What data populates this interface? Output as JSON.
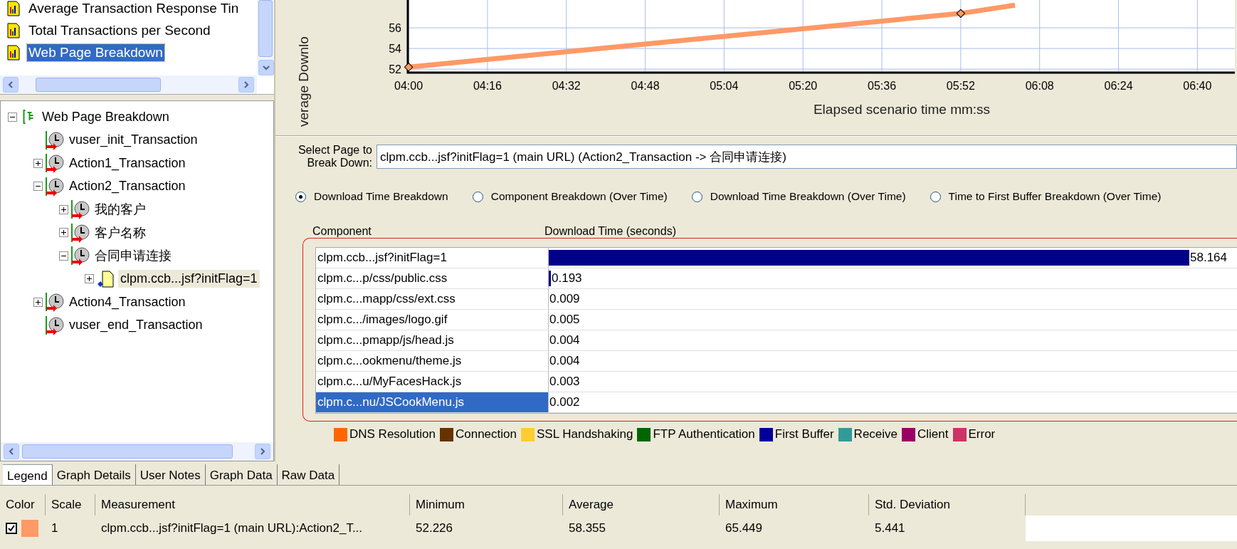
{
  "graph_list": {
    "items": [
      {
        "label": "Average Transaction Response Tin",
        "selected": false
      },
      {
        "label": "Total Transactions per Second",
        "selected": false
      },
      {
        "label": "Web Page Breakdown",
        "selected": true
      }
    ]
  },
  "tree": {
    "items": [
      {
        "label": "Web Page Breakdown",
        "kind": "root",
        "expanded": true,
        "selected": false,
        "children": [
          {
            "label": "vuser_init_Transaction",
            "kind": "transaction",
            "selected": false
          },
          {
            "label": "Action1_Transaction",
            "kind": "transaction",
            "expanded": false,
            "selected": false
          },
          {
            "label": "Action2_Transaction",
            "kind": "transaction",
            "expanded": true,
            "selected": false,
            "children": [
              {
                "label": "我的客户",
                "kind": "transaction",
                "expanded": false,
                "selected": false
              },
              {
                "label": "客户名称",
                "kind": "transaction",
                "expanded": false,
                "selected": false
              },
              {
                "label": "合同申请连接",
                "kind": "transaction",
                "expanded": true,
                "selected": false,
                "children": [
                  {
                    "label": "clpm.ccb...jsf?initFlag=1",
                    "kind": "page",
                    "expanded": false,
                    "selected": true
                  }
                ]
              }
            ]
          },
          {
            "label": "Action4_Transaction",
            "kind": "transaction",
            "expanded": false,
            "selected": false
          },
          {
            "label": "vuser_end_Transaction",
            "kind": "transaction",
            "selected": false
          }
        ]
      }
    ]
  },
  "chart": {
    "chart_data": {
      "type": "line",
      "xlabel": "Elapsed scenario time mm:ss",
      "annotations": [
        {
          "text": "verage Downlo"
        }
      ],
      "grid": true,
      "x": [
        240,
        352,
        363
      ],
      "series": [
        {
          "color": "#ff9966",
          "values": [
            52.2,
            57.4,
            58.2
          ]
        }
      ],
      "xlim": [
        239.7,
        407.6
      ],
      "ylim": [
        51.8,
        58.7
      ],
      "xticks": [
        {
          "value": 240,
          "label": "04:00"
        },
        {
          "value": 256,
          "label": "04:16"
        },
        {
          "value": 272,
          "label": "04:32"
        },
        {
          "value": 288,
          "label": "04:48"
        },
        {
          "value": 304,
          "label": "05:04"
        },
        {
          "value": 320,
          "label": "05:20"
        },
        {
          "value": 336,
          "label": "05:36"
        },
        {
          "value": 352,
          "label": "05:52"
        },
        {
          "value": 368,
          "label": "06:08"
        },
        {
          "value": 384,
          "label": "06:24"
        },
        {
          "value": 400,
          "label": "06:40"
        }
      ],
      "yticks": [
        52,
        54,
        56
      ]
    }
  },
  "select_page": {
    "label": "Select Page to Break Down:",
    "value": "clpm.ccb...jsf?initFlag=1 (main URL) (Action2_Transaction -> 合同申请连接)"
  },
  "breakdown_options": [
    {
      "label": "Download Time Breakdown",
      "selected": true
    },
    {
      "label": "Component Breakdown (Over Time)",
      "selected": false
    },
    {
      "label": "Download Time Breakdown (Over Time)",
      "selected": false
    },
    {
      "label": "Time to First Buffer Breakdown (Over Time)",
      "selected": false
    }
  ],
  "breakdown_table": {
    "columns": [
      "Component",
      "Download Time (seconds)"
    ],
    "rows": [
      {
        "component": "clpm.ccb...jsf?initFlag=1",
        "time": "58.164",
        "selected": false
      },
      {
        "component": "clpm.c...p/css/public.css",
        "time": "0.193",
        "selected": false
      },
      {
        "component": "clpm.c...mapp/css/ext.css",
        "time": "0.009",
        "selected": false
      },
      {
        "component": "clpm.c.../images/logo.gif",
        "time": "0.005",
        "selected": false
      },
      {
        "component": "clpm.c...pmapp/js/head.js",
        "time": "0.004",
        "selected": false
      },
      {
        "component": "clpm.c...ookmenu/theme.js",
        "time": "0.004",
        "selected": false
      },
      {
        "component": "clpm.c...u/MyFacesHack.js",
        "time": "0.003",
        "selected": false
      },
      {
        "component": "clpm.c...nu/JSCookMenu.js",
        "time": "0.002",
        "selected": true
      }
    ]
  },
  "legend": [
    {
      "label": "DNS Resolution",
      "color": "#ff6600"
    },
    {
      "label": "Connection",
      "color": "#663300"
    },
    {
      "label": "SSL Handshaking",
      "color": "#ffcc33"
    },
    {
      "label": "FTP Authentication",
      "color": "#006600"
    },
    {
      "label": "First Buffer",
      "color": "#000099"
    },
    {
      "label": "Receive",
      "color": "#339999"
    },
    {
      "label": "Client",
      "color": "#990066"
    },
    {
      "label": "Error",
      "color": "#cc3366"
    }
  ],
  "bottom_tabs": [
    {
      "label": "Legend",
      "selected": true
    },
    {
      "label": "Graph Details",
      "selected": false
    },
    {
      "label": "User Notes",
      "selected": false
    },
    {
      "label": "Graph Data",
      "selected": false
    },
    {
      "label": "Raw Data",
      "selected": false
    }
  ],
  "measurements": {
    "columns": [
      "Color",
      "Scale",
      "Measurement",
      "Minimum",
      "Average",
      "Maximum",
      "Std. Deviation"
    ],
    "rows": [
      {
        "checked": true,
        "color": "#ff9966",
        "scale": "1",
        "measurement": "clpm.ccb...jsf?initFlag=1 (main URL):Action2_T...",
        "minimum": "52.226",
        "average": "58.355",
        "maximum": "65.449",
        "std_deviation": "5.441"
      }
    ]
  }
}
